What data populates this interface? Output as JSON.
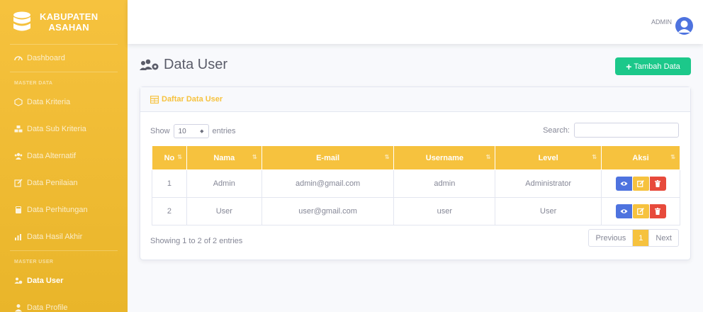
{
  "brand": {
    "line1": "KABUPATEN",
    "line2": "ASAHAN"
  },
  "sidebar": {
    "dashboard": "Dashboard",
    "heading_master_data": "MASTER DATA",
    "items": [
      {
        "label": "Data Kriteria",
        "icon": "cube-icon"
      },
      {
        "label": "Data Sub Kriteria",
        "icon": "cubes-icon"
      },
      {
        "label": "Data Alternatif",
        "icon": "users-icon"
      },
      {
        "label": "Data Penilaian",
        "icon": "edit-icon"
      },
      {
        "label": "Data Perhitungan",
        "icon": "calculator-icon"
      },
      {
        "label": "Data Hasil Akhir",
        "icon": "chart-icon"
      }
    ],
    "heading_master_user": "MASTER USER",
    "data_user": "Data User",
    "data_profile": "Data Profile"
  },
  "topbar": {
    "user_name": "ADMIN"
  },
  "page": {
    "title": "Data User",
    "add_button": "Tambah Data"
  },
  "card": {
    "title": "Daftar Data User",
    "show_label": "Show",
    "entries_value": "10",
    "entries_label": "entries",
    "search_label": "Search:",
    "columns": [
      "No",
      "Nama",
      "E-mail",
      "Username",
      "Level",
      "Aksi"
    ],
    "rows": [
      {
        "no": "1",
        "nama": "Admin",
        "email": "admin@gmail.com",
        "username": "admin",
        "level": "Administrator"
      },
      {
        "no": "2",
        "nama": "User",
        "email": "user@gmail.com",
        "username": "user",
        "level": "User"
      }
    ],
    "info": "Showing 1 to 2 of 2 entries",
    "pagination": {
      "previous": "Previous",
      "current": "1",
      "next": "Next"
    }
  },
  "colors": {
    "primary": "#f6c23e",
    "success": "#1cc88a",
    "info": "#4e73df",
    "danger": "#e74a3b"
  }
}
